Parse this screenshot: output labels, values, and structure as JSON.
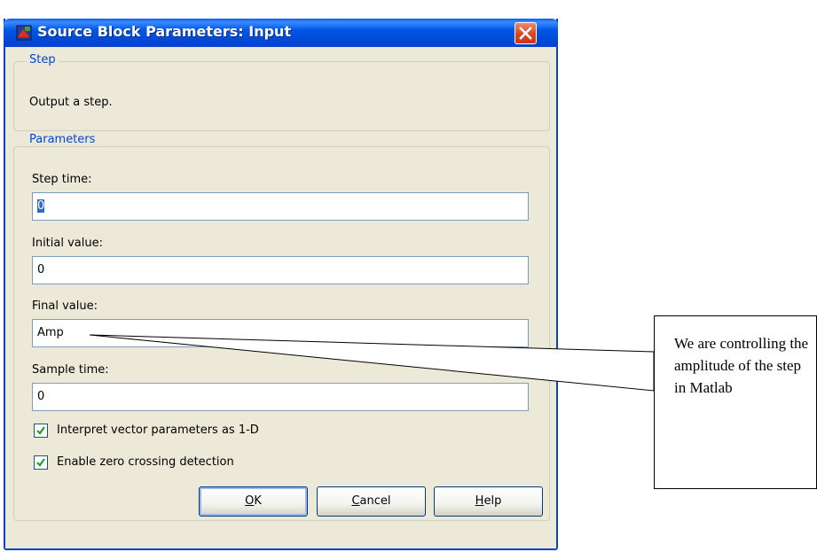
{
  "window": {
    "title": "Source Block Parameters: Input",
    "icons": {
      "app": "simulink-block-icon",
      "close": "close-icon"
    }
  },
  "step_group": {
    "legend": "Step",
    "description": "Output a step."
  },
  "params_group": {
    "legend": "Parameters",
    "step_time": {
      "label": "Step time:",
      "value": "0"
    },
    "initial_value": {
      "label": "Initial value:",
      "value": "0"
    },
    "final_value": {
      "label": "Final value:",
      "value": "Amp"
    },
    "sample_time": {
      "label": "Sample time:",
      "value": "0"
    },
    "interpret_vector": {
      "label": "Interpret vector parameters as 1-D",
      "checked": true
    },
    "zero_crossing": {
      "label": "Enable zero crossing detection",
      "checked": true
    }
  },
  "buttons": {
    "ok": {
      "mnemonic": "O",
      "rest": "K"
    },
    "cancel": {
      "mnemonic": "C",
      "rest": "ancel"
    },
    "help": {
      "mnemonic": "H",
      "rest": "elp"
    }
  },
  "annotation": {
    "text": "We are controlling the amplitude of the step in Matlab"
  },
  "colors": {
    "titlebar": "#0054e3",
    "dialog_bg": "#ece9d8",
    "legend_text": "#0046d5",
    "close_button": "#d9441e",
    "selection": "#316ac5"
  }
}
